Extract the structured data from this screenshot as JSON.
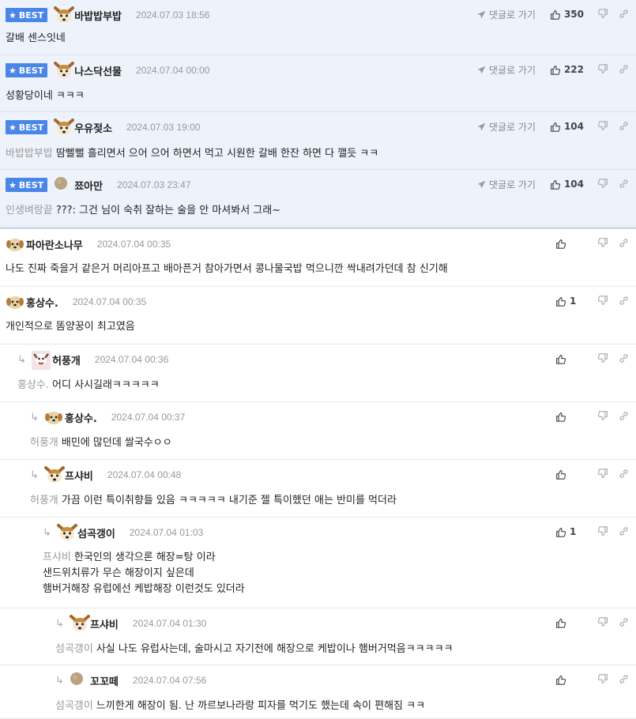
{
  "labels": {
    "best": "BEST",
    "goto_reply": "댓글로 가기"
  },
  "comments": [
    {
      "best": true,
      "nick": "바밥밥부밥",
      "date": "2024.07.03 18:56",
      "mention": "",
      "lines": [
        "갈배 센스잇네"
      ],
      "likes": "350",
      "avatar": "dog"
    },
    {
      "best": true,
      "nick": "나스닥선물",
      "date": "2024.07.04 00:00",
      "mention": "",
      "lines": [
        "성황당이네 ㅋㅋㅋ"
      ],
      "likes": "222",
      "avatar": "dog"
    },
    {
      "best": true,
      "nick": "우유젖소",
      "date": "2024.07.03 19:00",
      "mention": "바밥밥부밥",
      "lines": [
        "땀뻘뻘 흘리면서 으어 으어 하면서 먹고 시원한 갈배 한잔 하면 다 깰듯 ㅋㅋ"
      ],
      "likes": "104",
      "avatar": "dog"
    },
    {
      "best": true,
      "nick": "쬬아만",
      "date": "2024.07.03 23:47",
      "mention": "인생벼랑끝",
      "lines": [
        "???: 그건 님이 숙취 잘하는 술을 안 마셔봐서 그래~"
      ],
      "likes": "104",
      "avatar": "ball"
    },
    {
      "best": false,
      "nick": "파아란소나무",
      "date": "2024.07.04 00:35",
      "mention": "",
      "lines": [
        "나도 진짜 죽을거 같은거 머리아프고 배아픈거 참아가면서 콩나물국밥 먹으니깐 싹내려가던데 참 신기해"
      ],
      "likes": "",
      "avatar": "puppy"
    },
    {
      "best": false,
      "nick": "홍상수.",
      "date": "2024.07.04 00:35",
      "mention": "",
      "lines": [
        "개인적으로 똠양꿍이 최고였음"
      ],
      "likes": "1",
      "avatar": "puppy"
    },
    {
      "best": false,
      "nick": "허풍개",
      "date": "2024.07.04 00:36",
      "mention": "홍상수.",
      "lines": [
        "어디 사시길래ㅋㅋㅋㅋㅋ"
      ],
      "likes": "",
      "avatar": "photo"
    },
    {
      "best": false,
      "nick": "홍상수.",
      "date": "2024.07.04 00:37",
      "mention": "허풍개",
      "lines": [
        "배민에 많던데 쌀국수ㅇㅇ"
      ],
      "likes": "",
      "avatar": "puppy"
    },
    {
      "best": false,
      "nick": "프샤비",
      "date": "2024.07.04 00:48",
      "mention": "허풍개",
      "lines": [
        "가끔 이런 특이취향들 있음 ㅋㅋㅋㅋㅋ 내기준 젤 특이했던 애는 반미를 먹더라"
      ],
      "likes": "",
      "avatar": "dog"
    },
    {
      "best": false,
      "nick": "섬곡갱이",
      "date": "2024.07.04 01:03",
      "mention": "프샤비",
      "lines": [
        "한국인의 생각으론 해장=탕 이라",
        "샌드위치류가 무슨 해장이지 싶은데",
        "햄버거해장 유럽에선 케밥해장 이런것도 있더라"
      ],
      "likes": "1",
      "avatar": "dog"
    },
    {
      "best": false,
      "nick": "프샤비",
      "date": "2024.07.04 01:30",
      "mention": "섬곡갱이",
      "lines": [
        "사실 나도 유럽사는데, 술마시고 자기전에 해장으로 케밥이나 햄버거먹음ㅋㅋㅋㅋㅋ"
      ],
      "likes": "",
      "avatar": "dog"
    },
    {
      "best": false,
      "nick": "꼬꼬떼",
      "date": "2024.07.04 07:56",
      "mention": "섬곡갱이",
      "lines": [
        "느끼한게 해장이 됨. 난 까르보나라랑 피자를 먹기도 했는데 속이 편해짐 ㅋㅋ"
      ],
      "likes": "",
      "avatar": "ball"
    }
  ],
  "colors": {
    "best_badge": "#4a86e8",
    "best_bg": "#eef3fb",
    "mention": "#999999"
  }
}
